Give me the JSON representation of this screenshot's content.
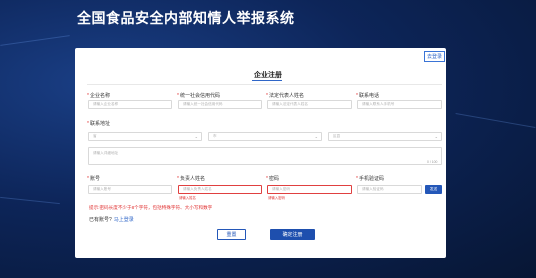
{
  "site": {
    "title": "全国食品安全内部知情人举报系统"
  },
  "header": {
    "login_link": "去登录"
  },
  "form": {
    "title": "企业注册",
    "fields": {
      "company_name": {
        "label": "企业名称",
        "placeholder": "请输入企业名称"
      },
      "credit_code": {
        "label": "统一社会信用代码",
        "placeholder": "请输入统一社会信用代码"
      },
      "legal_rep": {
        "label": "法定代表人姓名",
        "placeholder": "请输入法定代表人姓名"
      },
      "phone": {
        "label": "联系电话",
        "placeholder": "请输入联系人手机号"
      },
      "address": {
        "label": "联系地址",
        "province": "省",
        "city": "市",
        "district": "区县",
        "detail_placeholder": "请输入详细地址",
        "counter": "0 / 100"
      },
      "account": {
        "label": "账号",
        "placeholder": "请输入账号"
      },
      "person": {
        "label": "负责人姓名",
        "placeholder": "请输入负责人姓名",
        "error": "请输入姓名"
      },
      "password": {
        "label": "密码",
        "placeholder": "请输入密码",
        "error": "请输入密码"
      },
      "sms_code": {
        "label": "手机验证码",
        "placeholder": "请输入验证码",
        "send_button": "发送"
      }
    },
    "password_tip": "提示:密码长度不少于8个字符，包括特殊字符、大小写和数字",
    "has_account": {
      "text": "已有账号?",
      "link": "马上登录"
    },
    "buttons": {
      "reset": "重置",
      "submit": "确定注册"
    }
  },
  "colors": {
    "primary": "#1e4fae",
    "error": "#e03030",
    "background": "#0d2559"
  }
}
